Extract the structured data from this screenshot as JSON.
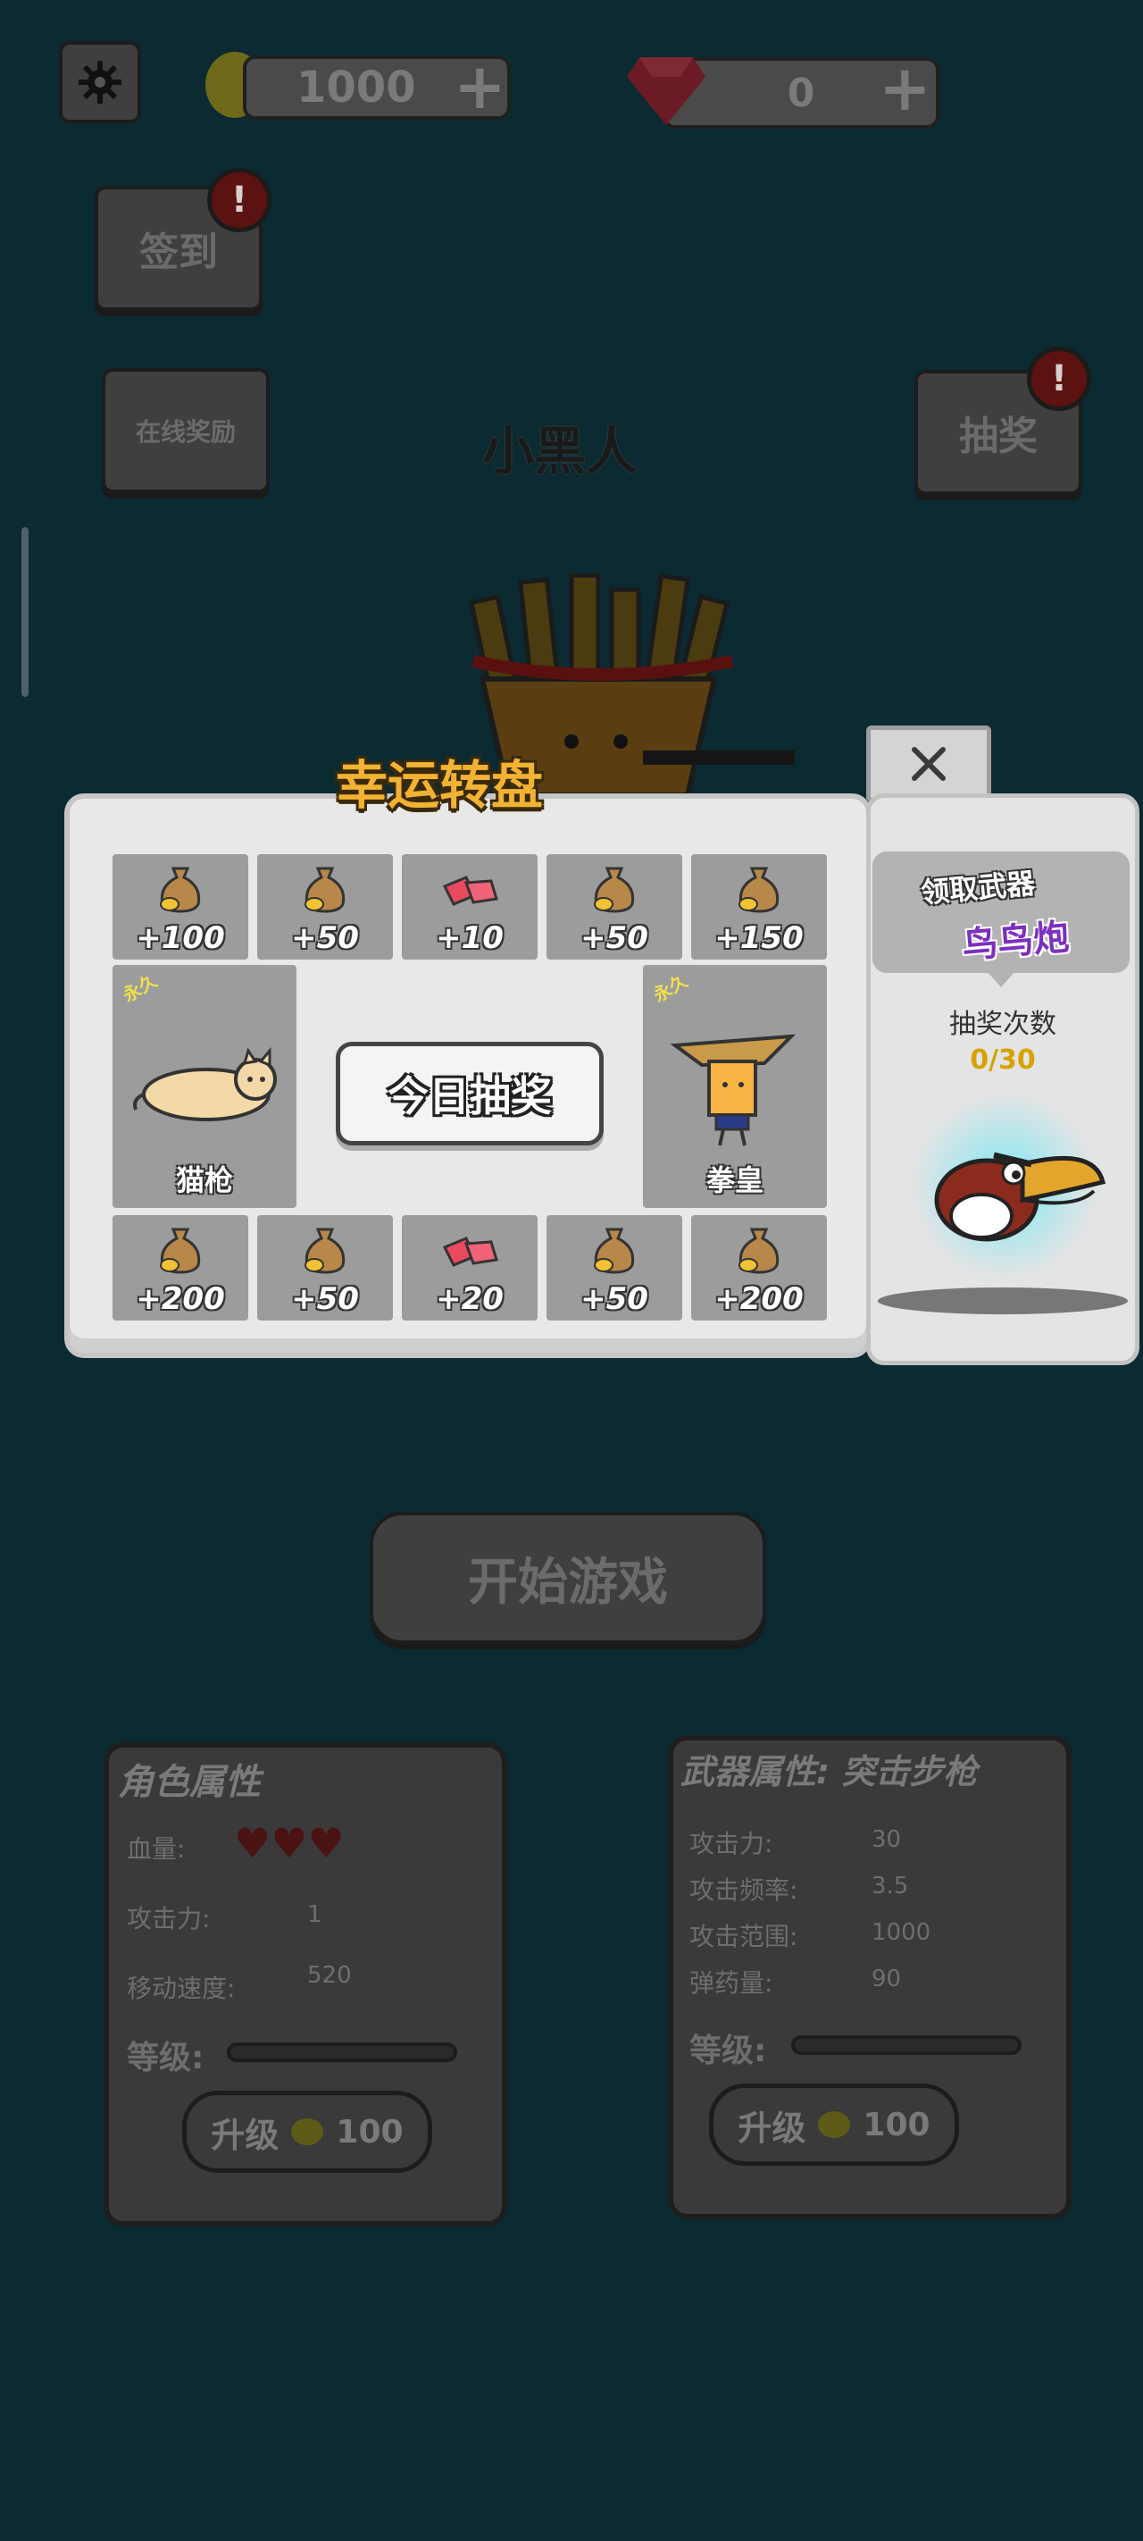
{
  "top_bar": {
    "coins": "1000",
    "gems": "0",
    "plus": "+"
  },
  "side_buttons": {
    "signin": "签到",
    "online_reward": "在线奖励",
    "lottery": "抽奖",
    "badge_mark": "!"
  },
  "character_name": "小黑人",
  "wheel": {
    "title": "幸运转盘",
    "spin_button": "今日抽奖",
    "top_cells": [
      "+100",
      "+50",
      "+10",
      "+50",
      "+150"
    ],
    "bottom_cells": [
      "+200",
      "+50",
      "+20",
      "+50",
      "+200"
    ],
    "left_prize": {
      "name": "猫枪",
      "tag": "永久"
    },
    "right_prize": {
      "name": "拳皇",
      "tag": "永久"
    }
  },
  "side_panel": {
    "claim_label": "领取武器",
    "weapon_name": "鸟鸟炮",
    "count_label": "抽奖次数",
    "count_value": "0/30"
  },
  "start_button": "开始游戏",
  "character_stats": {
    "title": "角色属性",
    "hp_label": "血量:",
    "attack_label": "攻击力:",
    "attack_value": "1",
    "speed_label": "移动速度:",
    "speed_value": "520",
    "level_label": "等级:",
    "upgrade_label": "升级",
    "upgrade_cost": "100"
  },
  "weapon_stats": {
    "title": "武器属性: 突击步枪",
    "attack_label": "攻击力:",
    "attack_value": "30",
    "rate_label": "攻击频率:",
    "rate_value": "3.5",
    "range_label": "攻击范围:",
    "range_value": "1000",
    "ammo_label": "弹药量:",
    "ammo_value": "90",
    "level_label": "等级:",
    "upgrade_label": "升级",
    "upgrade_cost": "100"
  },
  "colors": {
    "background": "#0b2a31",
    "gold_title": "#f2b233",
    "weapon_name_purple": "#7b2fbf",
    "count_gold": "#d6a200"
  }
}
